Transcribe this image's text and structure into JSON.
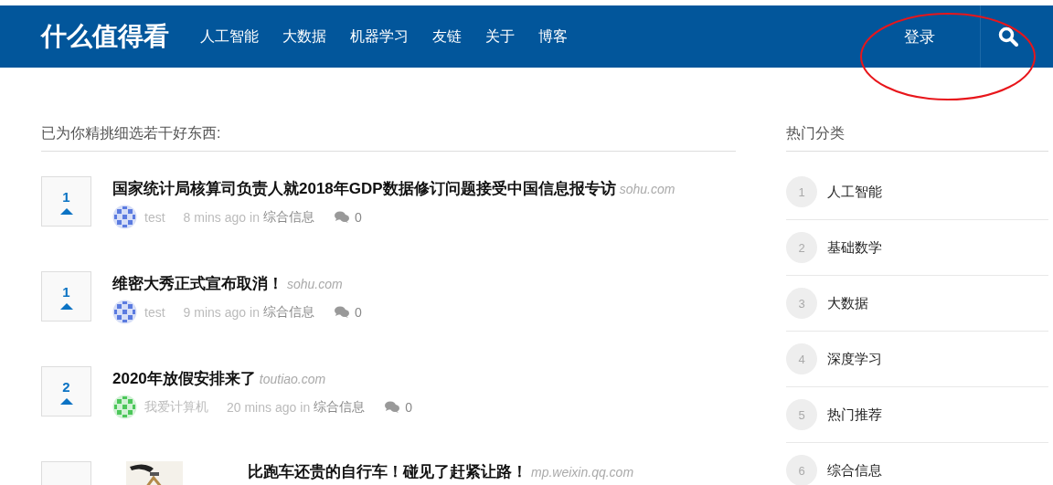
{
  "header": {
    "logo": "什么值得看",
    "nav": [
      "人工智能",
      "大数据",
      "机器学习",
      "友链",
      "关于",
      "博客"
    ],
    "login": "登录"
  },
  "main": {
    "heading": "已为你精挑细选若干好东西:",
    "posts": [
      {
        "kind": "text",
        "votes": "1",
        "title": "国家统计局核算司负责人就2018年GDP数据修订问题接受中国信息报专访",
        "source": "sohu.com",
        "author": "test",
        "color": "#5b7be0",
        "time": "8 mins ago",
        "in": "in",
        "category": "综合信息",
        "comments": "0"
      },
      {
        "kind": "text",
        "votes": "1",
        "title": "维密大秀正式宣布取消！",
        "source": "sohu.com",
        "author": "test",
        "color": "#5b7be0",
        "time": "9 mins ago",
        "in": "in",
        "category": "综合信息",
        "comments": "0"
      },
      {
        "kind": "text",
        "votes": "2",
        "title": "2020年放假安排来了",
        "source": "toutiao.com",
        "author": "我爱计算机",
        "color": "#4cc75a",
        "time": "20 mins ago",
        "in": "in",
        "category": "综合信息",
        "comments": "0"
      },
      {
        "kind": "thumbnail",
        "title": "比跑车还贵的自行车！碰见了赶紧让路！",
        "source": "mp.weixin.qq.com"
      }
    ]
  },
  "sidebar": {
    "heading": "热门分类",
    "items": [
      {
        "number": "1",
        "label": "人工智能"
      },
      {
        "number": "2",
        "label": "基础数学"
      },
      {
        "number": "3",
        "label": "大数据"
      },
      {
        "number": "4",
        "label": "深度学习"
      },
      {
        "number": "5",
        "label": "热门推荐"
      },
      {
        "number": "6",
        "label": "综合信息"
      }
    ]
  }
}
